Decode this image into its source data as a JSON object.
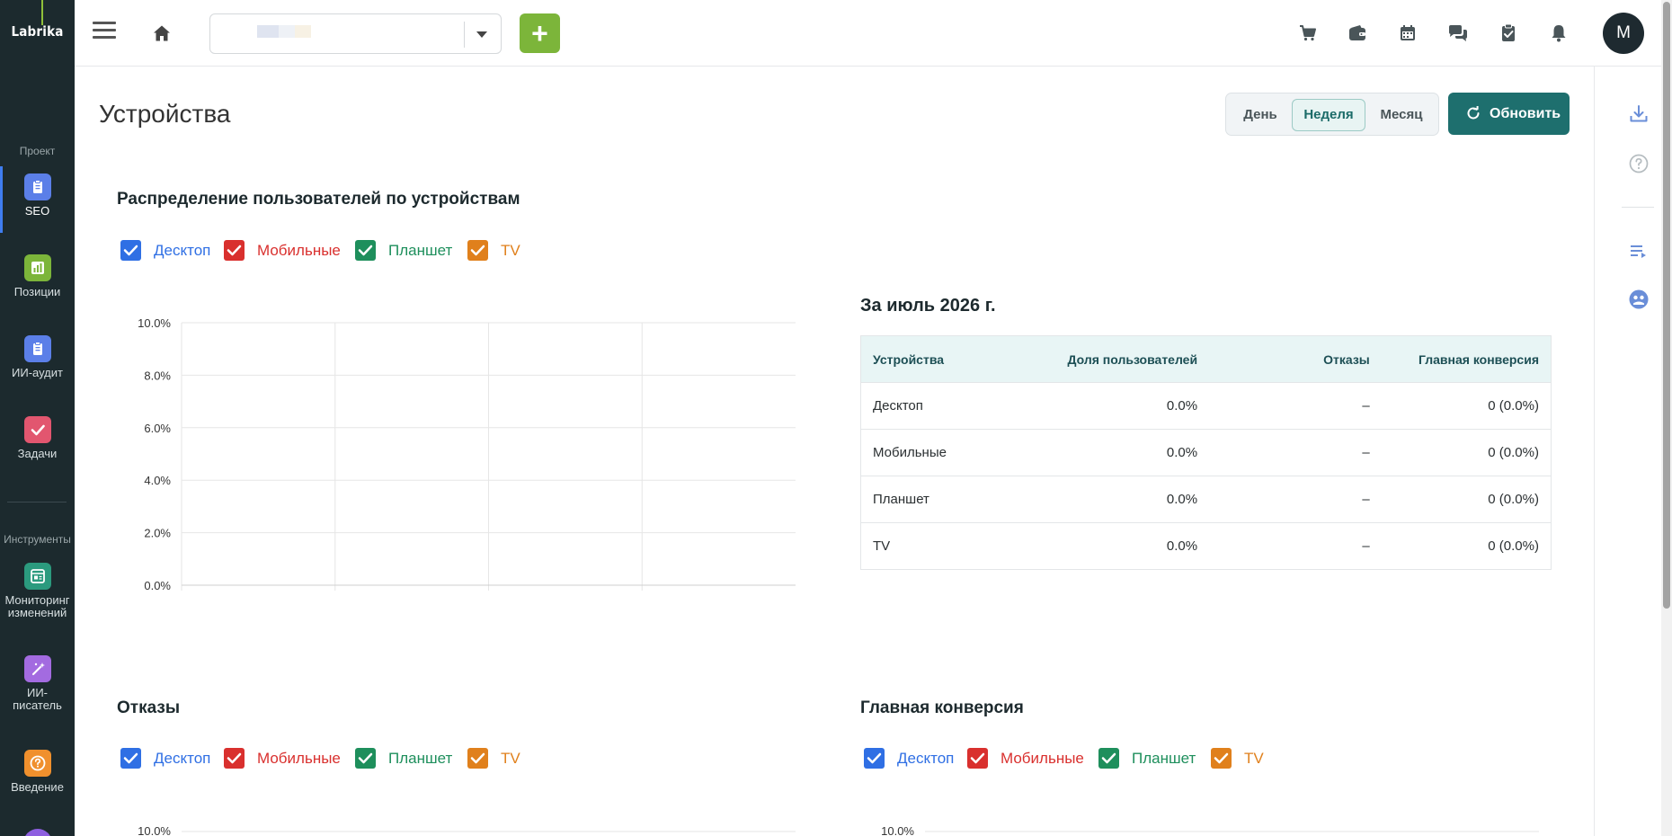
{
  "app": {
    "logo": "Labrika"
  },
  "sidebar": {
    "sections": [
      "Проект",
      "Инструменты"
    ],
    "items": [
      {
        "label": "SEO",
        "icon": "clipboard-icon",
        "color": "#5b7fe8",
        "active": true
      },
      {
        "label": "Позиции",
        "icon": "chart-icon",
        "color": "#7cb53a"
      },
      {
        "label": "ИИ-аудит",
        "icon": "clipboard-icon",
        "color": "#5b7fe8"
      },
      {
        "label": "Задачи",
        "icon": "check-icon",
        "color": "#e2566f"
      },
      {
        "label": "Мониторинг изменений",
        "icon": "monitor-icon",
        "color": "#2b9a7e"
      },
      {
        "label": "ИИ-писатель",
        "icon": "magic-wand-icon",
        "color": "#a36be0"
      },
      {
        "label": "Введение",
        "icon": "question-icon",
        "color": "#f0902d"
      }
    ]
  },
  "topbar": {
    "project_value": "",
    "add_label": "+",
    "icons": [
      "cart-icon",
      "wallet-icon",
      "calendar-icon",
      "chat-icon",
      "clipboard-check-icon",
      "bell-icon"
    ],
    "avatar_letter": "M"
  },
  "page": {
    "title": "Устройства",
    "periods": [
      "День",
      "Неделя",
      "Месяц"
    ],
    "active_period": "Неделя",
    "refresh_label": "Обновить"
  },
  "legend": [
    {
      "label": "Десктоп",
      "color": "#2f6fe4"
    },
    {
      "label": "Мобильные",
      "color": "#d9302e"
    },
    {
      "label": "Планшет",
      "color": "#1e8f5c"
    },
    {
      "label": "TV",
      "color": "#e0801c"
    }
  ],
  "distribution": {
    "title": "Распределение пользователей по устройствам",
    "chart_data": {
      "type": "line",
      "title": "Распределение пользователей по устройствам",
      "yticks": [
        "0.0%",
        "2.0%",
        "4.0%",
        "6.0%",
        "8.0%",
        "10.0%"
      ],
      "ylim": [
        0,
        10
      ],
      "grid": true,
      "series": [
        {
          "name": "Десктоп",
          "values": []
        },
        {
          "name": "Мобильные",
          "values": []
        },
        {
          "name": "Планшет",
          "values": []
        },
        {
          "name": "TV",
          "values": []
        }
      ]
    }
  },
  "table": {
    "title": "За июль 2026 г.",
    "headers": [
      "Устройства",
      "Доля пользователей",
      "Отказы",
      "Главная конверсия"
    ],
    "rows": [
      [
        "Десктоп",
        "0.0%",
        "–",
        "0 (0.0%)"
      ],
      [
        "Мобильные",
        "0.0%",
        "–",
        "0 (0.0%)"
      ],
      [
        "Планшет",
        "0.0%",
        "–",
        "0 (0.0%)"
      ],
      [
        "TV",
        "0.0%",
        "–",
        "0 (0.0%)"
      ]
    ]
  },
  "bounces": {
    "title": "Отказы",
    "ytick_top": "10.0%"
  },
  "conversion": {
    "title": "Главная конверсия",
    "ytick_top": "10.0%"
  }
}
